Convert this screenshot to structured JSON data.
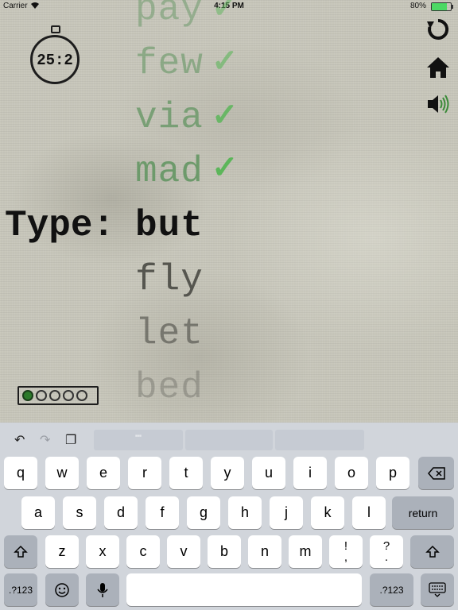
{
  "status_bar": {
    "carrier": "Carrier",
    "time": "4:15 PM",
    "battery_percent": "80%"
  },
  "timer": "25:2",
  "prompt_label": "Type:",
  "completed_words": [
    "pay",
    "few",
    "via",
    "mad"
  ],
  "current_word": "but",
  "upcoming_words": [
    "fly",
    "let",
    "bed"
  ],
  "lives": {
    "total": 5,
    "filled": 1
  },
  "controls": {
    "restart": "restart-icon",
    "home": "home-icon",
    "sound": "speaker-icon"
  },
  "keyboard": {
    "suggestion_1": "\"\"",
    "row1": [
      "q",
      "w",
      "e",
      "r",
      "t",
      "y",
      "u",
      "i",
      "o",
      "p"
    ],
    "row2": [
      "a",
      "s",
      "d",
      "f",
      "g",
      "h",
      "j",
      "k",
      "l"
    ],
    "row3": [
      "z",
      "x",
      "c",
      "v",
      "b",
      "n",
      "m"
    ],
    "exclaim_top": "!",
    "exclaim_bottom": ",",
    "question_top": "?",
    "question_bottom": ".",
    "return_label": "return",
    "numbers_label": ".?123",
    "numbers_label_right": ".?123"
  },
  "colors": {
    "check": "#5cb65a",
    "typed_word": "#6d9a6b",
    "life_on": "#2c7a2a"
  }
}
